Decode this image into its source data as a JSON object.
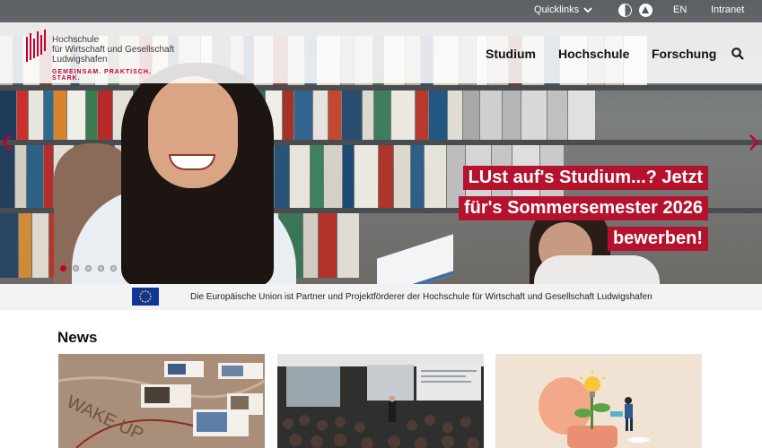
{
  "topbar": {
    "quicklinks": "Quicklinks",
    "language": "EN",
    "intranet": "Intranet"
  },
  "logo": {
    "line1": "Hochschule",
    "line2": "für Wirtschaft und Gesellschaft",
    "line3": "Ludwigshafen",
    "tagline": "GEMEINSAM. PRAKTISCH. STARK."
  },
  "nav": {
    "items": [
      "Studium",
      "Hochschule",
      "Forschung"
    ]
  },
  "hero": {
    "promo_lines": [
      "LUst auf's Studium...? Jetzt",
      "für's Sommersemester 2026",
      "bewerben!"
    ],
    "slide_count": 5,
    "active_slide": 1
  },
  "eu_banner": {
    "text": "Die Europäische Union ist Partner und Projektförderer der Hochschule für Wirtschaft und Gesellschaft Ludwigshafen"
  },
  "news": {
    "title": "News",
    "card1_image_text": "WAKE UP"
  },
  "colors": {
    "brand_red": "#c3002f",
    "promo_red": "#b5122e",
    "eu_blue": "#10359a"
  }
}
